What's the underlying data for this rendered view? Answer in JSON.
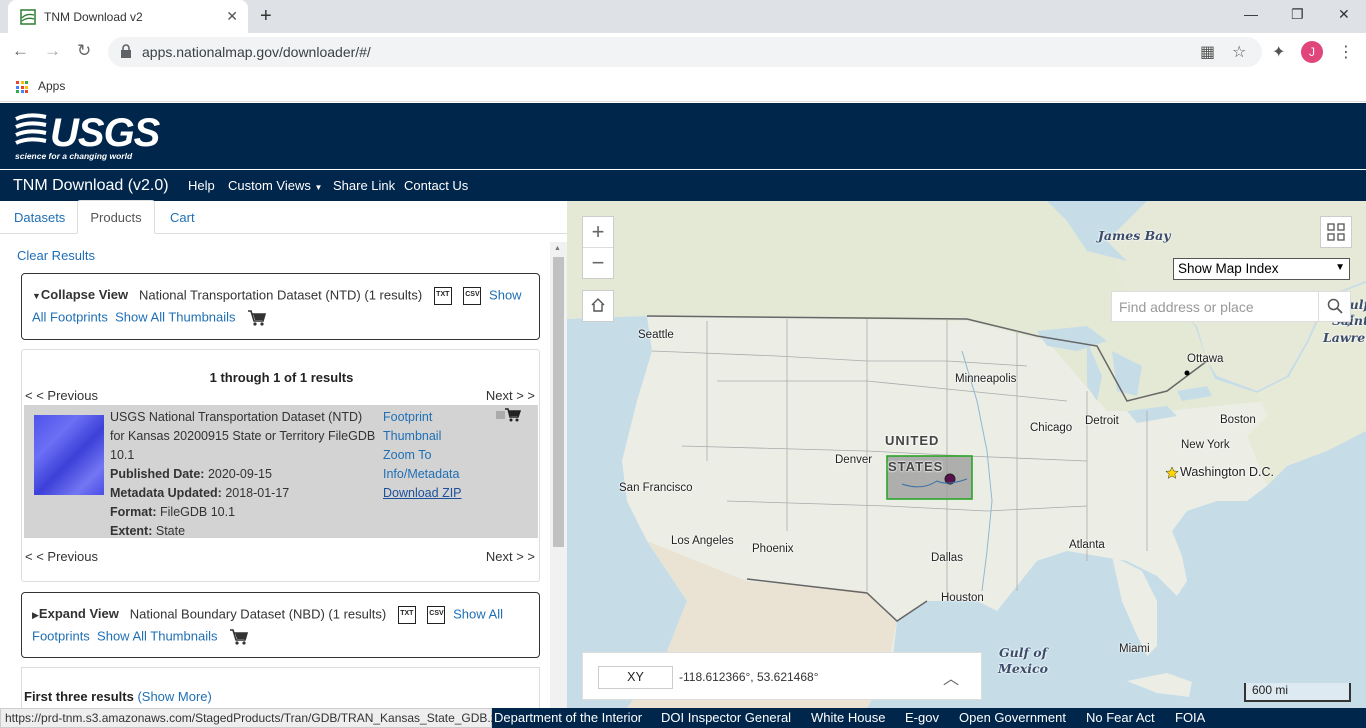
{
  "browser": {
    "tab_title": "TNM Download v2",
    "url": "apps.nationalmap.gov/downloader/#/",
    "bookmark_apps": "Apps",
    "avatar_letter": "J",
    "status_url": "https://prd-tnm.s3.amazonaws.com/StagedProducts/Tran/GDB/TRAN_Kansas_State_GDB.zip"
  },
  "header": {
    "logo_text": "USGS",
    "logo_tagline": "science for a changing world",
    "brand": "TNM Download (v2.0)",
    "nav": [
      "Help",
      "Custom Views",
      "Share Link",
      "Contact Us"
    ]
  },
  "panel": {
    "tabs": [
      "Datasets",
      "Products",
      "Cart"
    ],
    "clear_results": "Clear Results",
    "ntd": {
      "toggle": "Collapse View",
      "title": "National Transportation Dataset (NTD) (1 results)",
      "txt": "TXT",
      "csv": "CSV",
      "show": "Show",
      "all_footprints": "All Footprints",
      "show_all_thumbnails": "Show All Thumbnails"
    },
    "results": {
      "count": "1 through 1 of 1 results",
      "previous": "< < Previous",
      "next": "Next > >",
      "item": {
        "title": "USGS National Transportation Dataset (NTD) for Kansas 20200915 State or Territory FileGDB 10.1",
        "published_label": "Published Date:",
        "published": "2020-09-15",
        "metadata_label": "Metadata Updated:",
        "metadata": "2018-01-17",
        "format_label": "Format:",
        "format": "FileGDB 10.1",
        "extent_label": "Extent:",
        "extent": "State",
        "footprint": "Footprint",
        "thumbnail": "Thumbnail",
        "zoom_to": "Zoom To",
        "info_metadata": "Info/Metadata",
        "download": "Download ZIP"
      }
    },
    "nbd": {
      "toggle": "Expand View",
      "title": "National Boundary Dataset (NBD) (1 results)",
      "txt": "TXT",
      "csv": "CSV",
      "show_all": "Show All",
      "footprints": "Footprints",
      "show_all_thumbnails": "Show All Thumbnails"
    },
    "first_three": "First three results",
    "show_more": "(Show More)"
  },
  "map": {
    "map_index_select": "Show Map Index",
    "search_placeholder": "Find address or place",
    "coord_mode": "XY",
    "coord_value": "-118.612366°, 53.621468°",
    "scale": "600 mi",
    "labels": {
      "james_bay": "James Bay",
      "gulf_st": "Gulf of",
      "saint": "Saint",
      "lawrence": "Lawrence",
      "seattle": "Seattle",
      "ottawa": "Ottawa",
      "minneapolis": "Minneapolis",
      "united": "UNITED",
      "states": "STATES",
      "chicago": "Chicago",
      "detroit": "Detroit",
      "boston": "Boston",
      "new_york": "New York",
      "washington": "Washington D.C.",
      "denver": "Denver",
      "san_francisco": "San Francisco",
      "los_angeles": "Los Angeles",
      "phoenix": "Phoenix",
      "dallas": "Dallas",
      "atlanta": "Atlanta",
      "houston": "Houston",
      "gulf_of": "Gulf of",
      "mexico": "Mexico",
      "miami": "Miami"
    }
  },
  "footer": [
    "Department of the Interior",
    "DOI Inspector General",
    "White House",
    "E-gov",
    "Open Government",
    "No Fear Act",
    "FOIA"
  ]
}
